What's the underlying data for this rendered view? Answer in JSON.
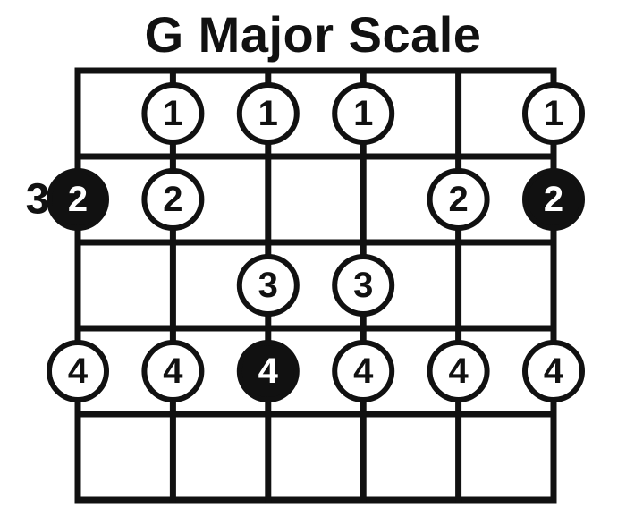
{
  "title": "G Major Scale",
  "fret_marker": {
    "label": "3",
    "fretIndex": 1
  },
  "layout": {
    "xStart": 87,
    "xEnd": 619,
    "yStart": 79,
    "yEnd": 559,
    "strings": 6,
    "frets": 5,
    "stringLine": 7,
    "fretLine": 7,
    "nutLine": 7,
    "dotRadius": 32,
    "dotStroke": 6,
    "dotFont": 40,
    "markerOffsetX": 45
  },
  "dots": [
    {
      "string": 1,
      "fret": 0.5,
      "finger": "1",
      "root": false
    },
    {
      "string": 2,
      "fret": 0.5,
      "finger": "1",
      "root": false
    },
    {
      "string": 3,
      "fret": 0.5,
      "finger": "1",
      "root": false
    },
    {
      "string": 5,
      "fret": 0.5,
      "finger": "1",
      "root": false
    },
    {
      "string": 0,
      "fret": 1.5,
      "finger": "2",
      "root": true
    },
    {
      "string": 1,
      "fret": 1.5,
      "finger": "2",
      "root": false
    },
    {
      "string": 4,
      "fret": 1.5,
      "finger": "2",
      "root": false
    },
    {
      "string": 5,
      "fret": 1.5,
      "finger": "2",
      "root": true
    },
    {
      "string": 2,
      "fret": 2.5,
      "finger": "3",
      "root": false
    },
    {
      "string": 3,
      "fret": 2.5,
      "finger": "3",
      "root": false
    },
    {
      "string": 0,
      "fret": 3.5,
      "finger": "4",
      "root": false
    },
    {
      "string": 1,
      "fret": 3.5,
      "finger": "4",
      "root": false
    },
    {
      "string": 2,
      "fret": 3.5,
      "finger": "4",
      "root": true
    },
    {
      "string": 3,
      "fret": 3.5,
      "finger": "4",
      "root": false
    },
    {
      "string": 4,
      "fret": 3.5,
      "finger": "4",
      "root": false
    },
    {
      "string": 5,
      "fret": 3.5,
      "finger": "4",
      "root": false
    }
  ]
}
